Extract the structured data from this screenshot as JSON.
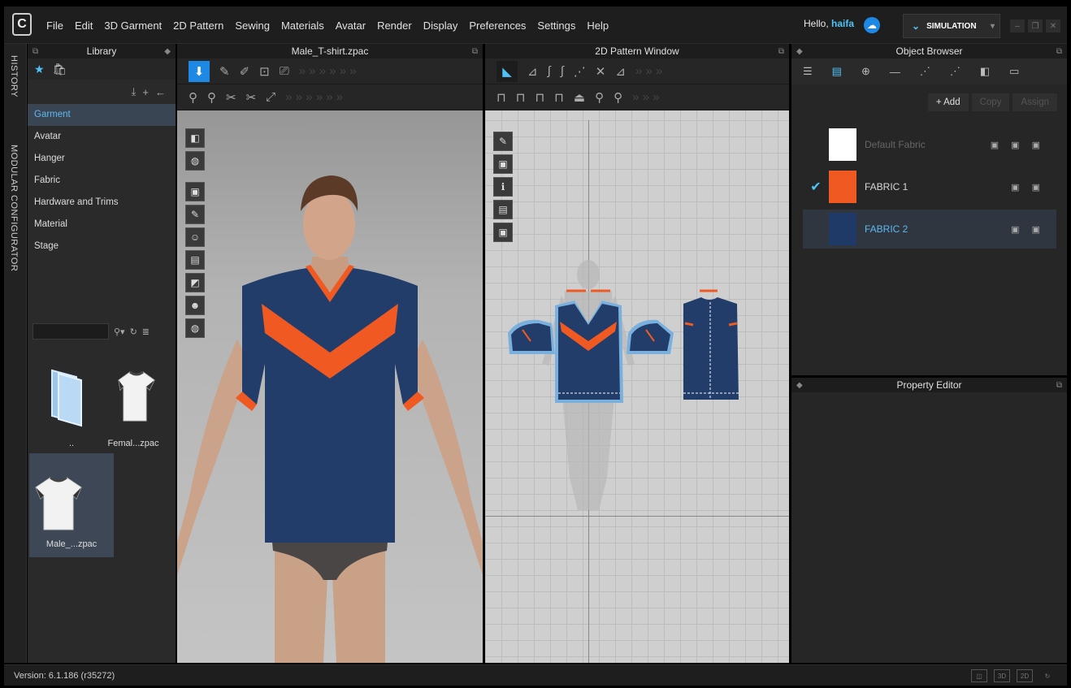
{
  "menu": {
    "items": [
      "File",
      "Edit",
      "3D Garment",
      "2D Pattern",
      "Sewing",
      "Materials",
      "Avatar",
      "Render",
      "Display",
      "Preferences",
      "Settings",
      "Help"
    ]
  },
  "user": {
    "greeting": "Hello,",
    "name": "haifa"
  },
  "simulation_label": "SIMULATION",
  "side_tabs": [
    "HISTORY",
    "MODULAR CONFIGURATOR"
  ],
  "library": {
    "title": "Library",
    "items": [
      "Garment",
      "Avatar",
      "Hanger",
      "Fabric",
      "Hardware and Trims",
      "Material",
      "Stage"
    ],
    "selected": "Garment",
    "thumbnails": [
      {
        "caption": ".."
      },
      {
        "caption": "Femal...zpac"
      },
      {
        "caption": "Male_...zpac"
      }
    ]
  },
  "view3d": {
    "title": "Male_T-shirt.zpac"
  },
  "view2d": {
    "title": "2D Pattern Window"
  },
  "object_browser": {
    "title": "Object Browser",
    "add_label": "+ Add",
    "copy_label": "Copy",
    "assign_label": "Assign",
    "fabrics": [
      {
        "name": "Default Fabric",
        "color": "#ffffff",
        "checked": false,
        "selected": false,
        "dim": true
      },
      {
        "name": "FABRIC 1",
        "color": "#f05a22",
        "checked": true,
        "selected": false,
        "dim": false
      },
      {
        "name": "FABRIC 2",
        "color": "#1f3a66",
        "checked": false,
        "selected": true,
        "dim": false
      }
    ]
  },
  "property_editor": {
    "title": "Property Editor"
  },
  "status": {
    "version": "Version: 6.1.186 (r35272)"
  },
  "colors": {
    "accent": "#4fc3f7",
    "navy": "#1f3a66",
    "orange": "#f05a22"
  }
}
